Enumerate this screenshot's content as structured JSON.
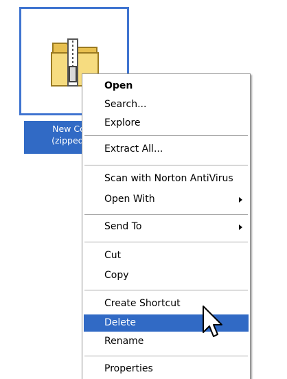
{
  "desktop_icon": {
    "name_line1": "New Comp",
    "name_line2": "(zipped) Fo",
    "icon": "zipped-folder-icon"
  },
  "context_menu": {
    "items": [
      {
        "label": "Open"
      },
      {
        "label": "Search..."
      },
      {
        "label": "Explore"
      },
      {
        "label": "Extract All..."
      },
      {
        "label": "Scan with Norton AntiVirus"
      },
      {
        "label": "Open With"
      },
      {
        "label": "Send To"
      },
      {
        "label": "Cut"
      },
      {
        "label": "Copy"
      },
      {
        "label": "Create Shortcut"
      },
      {
        "label": "Delete"
      },
      {
        "label": "Rename"
      },
      {
        "label": "Properties"
      }
    ]
  },
  "colors": {
    "selection": "#316ac5",
    "icon_border": "#3f74d0",
    "folder": "#f3d675"
  },
  "cursor": "arrow-pointer-icon"
}
